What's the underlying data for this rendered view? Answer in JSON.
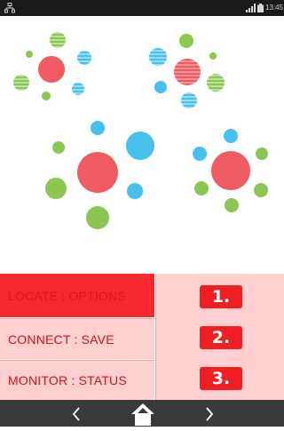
{
  "status_bar": {
    "time": "13:45",
    "icons": [
      "network-icon",
      "signal-icon",
      "battery-icon"
    ]
  },
  "colors": {
    "red": "#ef5b60",
    "blue": "#45c1ec",
    "green": "#8bc653",
    "menu_active_bg": "#f4282d",
    "menu_bg": "#ffd0d0",
    "menu_text": "#d01318",
    "badge_bg": "#f01d22"
  },
  "menu": {
    "items": [
      {
        "label": "LOCATE : OPTIONS",
        "number": "1."
      },
      {
        "label": "CONNECT : SAVE",
        "number": "2."
      },
      {
        "label": "MONITOR : STATUS",
        "number": "3."
      }
    ]
  },
  "nav": {
    "icons": [
      "chevron-left-icon",
      "home-icon",
      "chevron-right-icon"
    ]
  }
}
